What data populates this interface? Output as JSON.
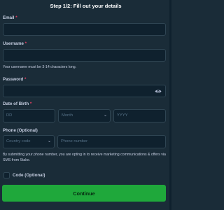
{
  "title": "Step 1/2: Fill out your details",
  "required_mark": "*",
  "email": {
    "label": "Email",
    "value": ""
  },
  "username": {
    "label": "Username",
    "value": "",
    "hint": "Your username must be 3-14 characters long."
  },
  "password": {
    "label": "Password",
    "value": "",
    "toggle_icon": "eye-icon"
  },
  "dob": {
    "label": "Date of Birth",
    "day_placeholder": "DD",
    "month_placeholder": "Month",
    "year_placeholder": "YYYY"
  },
  "phone": {
    "label": "Phone (Optional)",
    "country_placeholder": "Country code",
    "number_placeholder": "Phone number",
    "notice": "By submitting your phone number, you are opting in to receive marketing communications & offers via SMS from Stake."
  },
  "code": {
    "label": "Code (Optional)",
    "checked": false
  },
  "submit_label": "Continue",
  "colors": {
    "background": "#1a2c38",
    "input_background": "#0f212e",
    "input_border": "#2f4553",
    "required": "#ed4163",
    "button": "#1fa83b",
    "button_text": "#05280f"
  }
}
